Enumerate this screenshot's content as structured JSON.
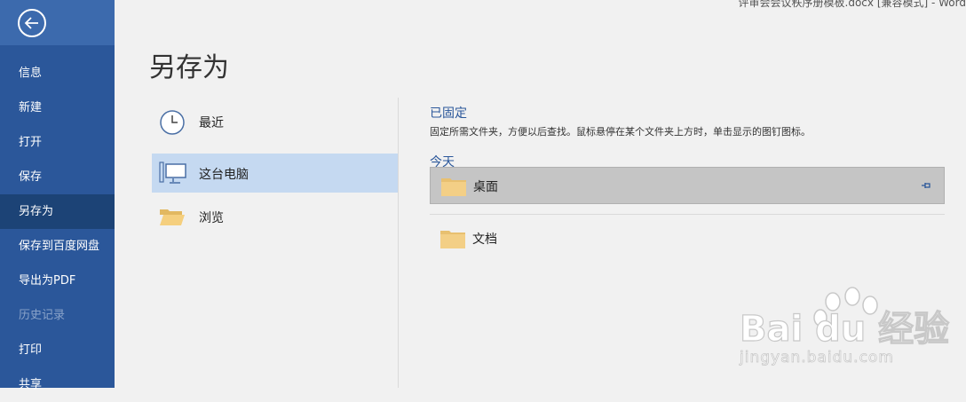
{
  "window": {
    "title": "评审会会议秩序册模板.docx [兼容模式] - Word"
  },
  "sidebar": {
    "items": [
      {
        "label": "信息",
        "state": "normal"
      },
      {
        "label": "新建",
        "state": "normal"
      },
      {
        "label": "打开",
        "state": "normal"
      },
      {
        "label": "保存",
        "state": "normal"
      },
      {
        "label": "另存为",
        "state": "active"
      },
      {
        "label": "保存到百度网盘",
        "state": "normal"
      },
      {
        "label": "导出为PDF",
        "state": "normal"
      },
      {
        "label": "历史记录",
        "state": "disabled"
      },
      {
        "label": "打印",
        "state": "normal"
      },
      {
        "label": "共享",
        "state": "normal"
      }
    ]
  },
  "main": {
    "title": "另存为",
    "locations": [
      {
        "label": "最近",
        "icon": "clock-icon"
      },
      {
        "label": "这台电脑",
        "icon": "computer-icon",
        "selected": true
      },
      {
        "label": "浏览",
        "icon": "folder-open-icon"
      }
    ],
    "pinned": {
      "heading": "已固定",
      "description": "固定所需文件夹，方便以后查找。鼠标悬停在某个文件夹上方时，单击显示的图钉图标。"
    },
    "today": {
      "heading": "今天",
      "folders": [
        {
          "name": "桌面",
          "icon": "folder-icon",
          "highlighted": true
        },
        {
          "name": "文档",
          "icon": "folder-icon"
        }
      ]
    }
  },
  "watermark": {
    "brand": "Bai du 经验",
    "url": "jingyan.baidu.com"
  },
  "colors": {
    "sidebar": "#2b579a",
    "accent": "#2b579a",
    "selected": "#c5d9f1"
  }
}
